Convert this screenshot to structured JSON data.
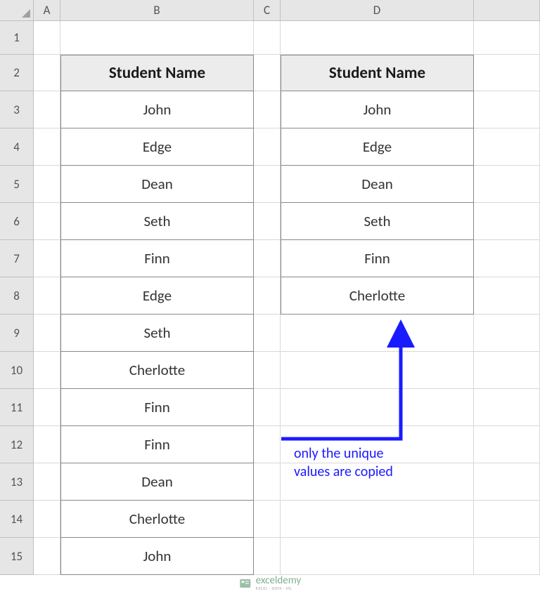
{
  "columns": [
    "A",
    "B",
    "C",
    "D"
  ],
  "rows": [
    "1",
    "2",
    "3",
    "4",
    "5",
    "6",
    "7",
    "8",
    "9",
    "10",
    "11",
    "12",
    "13",
    "14",
    "15"
  ],
  "table_b": {
    "header": "Student Name",
    "data": [
      "John",
      "Edge",
      "Dean",
      "Seth",
      "Finn",
      "Edge",
      "Seth",
      "Cherlotte",
      "Finn",
      "Finn",
      "Dean",
      "Cherlotte",
      "John"
    ]
  },
  "table_d": {
    "header": "Student Name",
    "data": [
      "John",
      "Edge",
      "Dean",
      "Seth",
      "Finn",
      "Cherlotte"
    ]
  },
  "annotation": {
    "line1": "only the unique",
    "line2": "values are copied"
  },
  "watermark": {
    "main": "exceldemy",
    "sub": "EXCEL · DATA · ML"
  }
}
